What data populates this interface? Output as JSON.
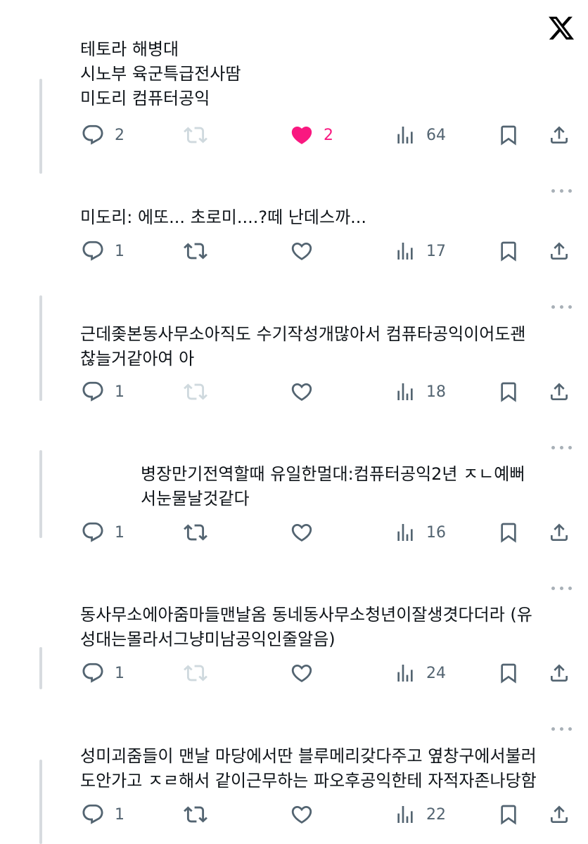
{
  "app": {
    "logo": "x-logo"
  },
  "icons": {
    "reply": "reply-icon",
    "retweet": "retweet-icon",
    "like": "heart-icon",
    "views": "views-icon",
    "bookmark": "bookmark-icon",
    "share": "share-icon",
    "more": "more-icon"
  },
  "colors": {
    "like_active": "#f91880",
    "icon": "#536471",
    "icon_disabled": "#cfd9de",
    "text": "#0f1419",
    "thread_line": "#d7dbdf"
  },
  "tweets": [
    {
      "text": "테토라 해병대\n시노부 육군특급전사땀\n미도리 컴퓨터공익",
      "replies": "2",
      "retweet_enabled": false,
      "liked": true,
      "likes": "2",
      "views": "64"
    },
    {
      "text": "미도리: 에또... 초로미....?떼 난데스까...",
      "replies": "1",
      "retweet_enabled": true,
      "liked": false,
      "likes": "",
      "views": "17"
    },
    {
      "text": "근데좆본동사무소아직도 수기작성개많아서 컴퓨타공익이어도괜\n찮늘거같아여 아",
      "replies": "1",
      "retweet_enabled": false,
      "liked": false,
      "likes": "",
      "views": "18"
    },
    {
      "text": "병장만기전역할때 유일한멀대:컴퓨터공익2년 ㅈㄴ예뻐\n서눈물날것같다",
      "replies": "1",
      "retweet_enabled": true,
      "liked": false,
      "likes": "",
      "views": "16"
    },
    {
      "text": "동사무소에아줌마들맨날옴 동네동사무소청년이잘생겻다더라 (유\n성대는몰라서그냥미남공익인줄알음)",
      "replies": "1",
      "retweet_enabled": false,
      "liked": false,
      "likes": "",
      "views": "24"
    },
    {
      "text": "성미괴줌들이 맨날 마당에서딴 블루메리갖다주고 옆창구에서불러\n도안가고 ㅈㄹ해서 같이근무하는 파오후공익한테 자적자존나당함",
      "replies": "1",
      "retweet_enabled": true,
      "liked": false,
      "likes": "",
      "views": "22"
    }
  ]
}
